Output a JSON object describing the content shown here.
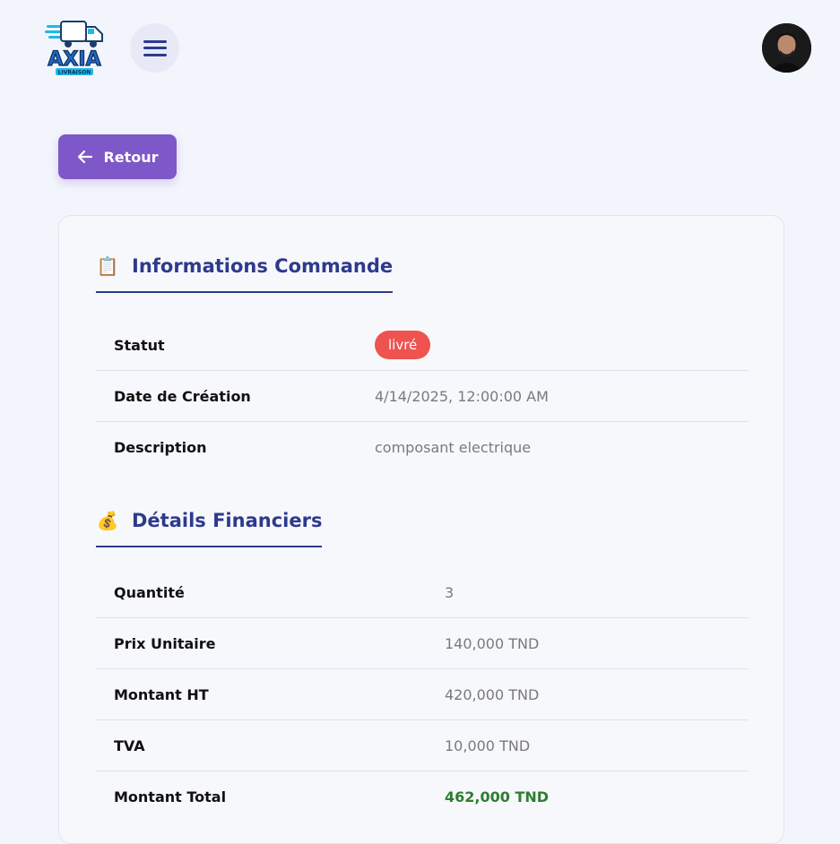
{
  "header": {
    "logo_text": "AXIA",
    "logo_subtext": "LIVRAISON",
    "menu_icon": "hamburger-icon",
    "avatar_icon": "user-avatar"
  },
  "back_button": {
    "label": "Retour",
    "icon": "arrow-left-icon"
  },
  "info_section": {
    "emoji": "📋",
    "title": "Informations Commande",
    "rows": [
      {
        "label": "Statut",
        "value": "livré"
      },
      {
        "label": "Date de Création",
        "value": "4/14/2025, 12:00:00 AM"
      },
      {
        "label": "Description",
        "value": "composant electrique"
      }
    ]
  },
  "finance_section": {
    "emoji": "💰",
    "title": "Détails Financiers",
    "rows": [
      {
        "label": "Quantité",
        "value": "3"
      },
      {
        "label": "Prix Unitaire",
        "value": "140,000 TND"
      },
      {
        "label": "Montant HT",
        "value": "420,000 TND"
      },
      {
        "label": "TVA",
        "value": "10,000 TND"
      },
      {
        "label": "Montant Total",
        "value": "462,000 TND"
      }
    ]
  },
  "colors": {
    "primary": "#2d3a8c",
    "button": "#7e57c8",
    "status_badge": "#ef5350",
    "total": "#2e7d32",
    "background": "#f3f5fc"
  }
}
